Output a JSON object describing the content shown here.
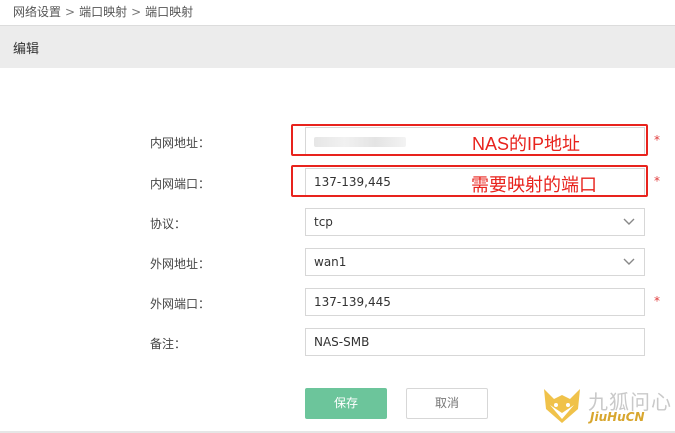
{
  "breadcrumb": {
    "items": [
      "网络设置",
      "端口映射",
      "端口映射"
    ],
    "separator": ">"
  },
  "header": {
    "title": "编辑"
  },
  "form": {
    "internal_address": {
      "label": "内网地址：",
      "value": "",
      "required_mark": "*"
    },
    "internal_port": {
      "label": "内网端口：",
      "value": "137-139,445",
      "required_mark": "*"
    },
    "protocol": {
      "label": "协议：",
      "value": "tcp"
    },
    "external_address": {
      "label": "外网地址：",
      "value": "wan1"
    },
    "external_port": {
      "label": "外网端口：",
      "value": "137-139,445",
      "required_mark": "*"
    },
    "remark": {
      "label": "备注：",
      "value": "NAS-SMB"
    }
  },
  "buttons": {
    "save_label": "保存",
    "cancel_label": "取消"
  },
  "annotations": {
    "address_note": "NAS的IP地址",
    "port_note": "需要映射的端口",
    "color": "#e8231d"
  },
  "watermark": {
    "cn": "九狐问心",
    "en": "JiuHuCN"
  },
  "colors": {
    "save_button": "#6cc59b",
    "required": "#e03c3c",
    "header_bg": "#ececec"
  }
}
